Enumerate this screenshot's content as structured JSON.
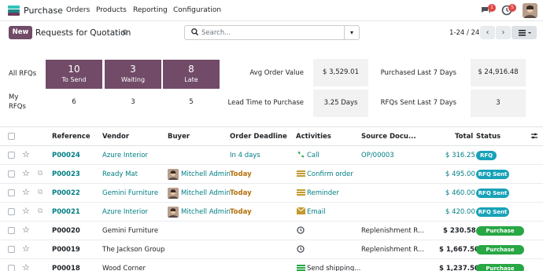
{
  "nav": {
    "app_name": "Purchase",
    "menu": [
      "Orders",
      "Products",
      "Reporting",
      "Configuration"
    ],
    "chat_badge": "1",
    "activity_badge": "5"
  },
  "control": {
    "new_label": "New",
    "title": "Requests for Quotation",
    "search_placeholder": "Search...",
    "pager": "1-24 / 24"
  },
  "dashboard": {
    "all_rfqs_label": "All RFQs",
    "my_rfqs_label_1": "My",
    "my_rfqs_label_2": "RFQs",
    "tiles": [
      {
        "count": "10",
        "label": "To Send",
        "mine": "6"
      },
      {
        "count": "3",
        "label": "Waiting",
        "mine": "3"
      },
      {
        "count": "8",
        "label": "Late",
        "mine": "5"
      }
    ],
    "stats": [
      {
        "label": "Avg Order Value",
        "value": "$ 3,529.01"
      },
      {
        "label": "Purchased Last 7 Days",
        "value": "$ 24,916.48"
      },
      {
        "label": "Lead Time to Purchase",
        "value": "3.25 Days"
      },
      {
        "label": "RFQs Sent Last 7 Days",
        "value": "3"
      }
    ]
  },
  "table": {
    "headers": {
      "reference": "Reference",
      "vendor": "Vendor",
      "buyer": "Buyer",
      "deadline": "Order Deadline",
      "activities": "Activities",
      "source": "Source Docu...",
      "total": "Total",
      "status": "Status"
    },
    "rows": [
      {
        "ref": "P00024",
        "vendor": "Azure Interior",
        "buyer": "",
        "deadline": "In 4 days",
        "activity": "Call",
        "source": "OP/00003",
        "total": "$ 316.25",
        "status": "RFQ"
      },
      {
        "ref": "P00023",
        "vendor": "Ready Mat",
        "buyer": "Mitchell Admin",
        "deadline": "Today",
        "activity": "Confirm order",
        "source": "",
        "total": "$ 495.00",
        "status": "RFQ Sent"
      },
      {
        "ref": "P00022",
        "vendor": "Gemini Furniture",
        "buyer": "Mitchell Admin",
        "deadline": "Today",
        "activity": "Reminder",
        "source": "",
        "total": "$ 460.00",
        "status": "RFQ Sent"
      },
      {
        "ref": "P00021",
        "vendor": "Azure Interior",
        "buyer": "Mitchell Admin",
        "deadline": "Today",
        "activity": "Email",
        "source": "",
        "total": "$ 420.00",
        "status": "RFQ Sent"
      },
      {
        "ref": "P00020",
        "vendor": "Gemini Furniture",
        "buyer": "",
        "deadline": "",
        "activity": "",
        "source": "Replenishment R...",
        "total": "$ 230.58",
        "status": "Purchase Order"
      },
      {
        "ref": "P00019",
        "vendor": "The Jackson Group",
        "buyer": "",
        "deadline": "",
        "activity": "",
        "source": "Replenishment R...",
        "total": "$ 1,667.50",
        "status": "Purchase Order"
      },
      {
        "ref": "P00018",
        "vendor": "Wood Corner",
        "buyer": "",
        "deadline": "",
        "activity": "Send shipping...",
        "source": "",
        "total": "$ 1,237.50",
        "status": "Purchase Order"
      }
    ]
  },
  "colors": {
    "brand": "#714b67",
    "link": "#017e84",
    "status_rfq": "#17a2b8",
    "status_po": "#28a745",
    "today": "#b2700a"
  }
}
